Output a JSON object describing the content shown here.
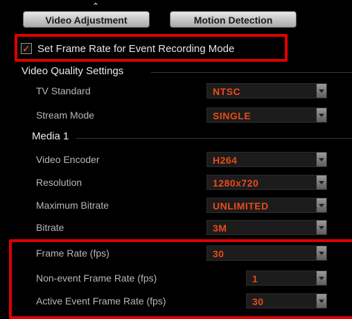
{
  "tabs": {
    "video_adjustment": "Video Adjustment",
    "motion_detection": "Motion Detection"
  },
  "event_recording": {
    "checkbox_checked": true,
    "check_glyph": "✓",
    "label": "Set Frame Rate for Event Recording Mode"
  },
  "video_quality": {
    "title": "Video Quality Settings",
    "tv_standard": {
      "label": "TV Standard",
      "value": "NTSC"
    },
    "stream_mode": {
      "label": "Stream Mode",
      "value": "SINGLE"
    }
  },
  "media1": {
    "title": "Media 1",
    "video_encoder": {
      "label": "Video Encoder",
      "value": "H264"
    },
    "resolution": {
      "label": "Resolution",
      "value": "1280x720"
    },
    "max_bitrate": {
      "label": "Maximum Bitrate",
      "value": "UNLIMITED"
    },
    "bitrate": {
      "label": "Bitrate",
      "value": "3M"
    },
    "frame_rate": {
      "label": "Frame Rate (fps)",
      "value": "30"
    },
    "nonevent_frame_rate": {
      "label": "Non-event Frame Rate (fps)",
      "value": "1"
    },
    "active_event_frame_rate": {
      "label": "Active Event Frame Rate (fps)",
      "value": "30"
    }
  },
  "colors": {
    "background": "#000000",
    "value_text": "#e84a1a",
    "highlight": "#e00000",
    "check": "#e07a1f"
  },
  "icons": {
    "cursor": "mouse-cursor-icon",
    "dropdown": "chevron-down-icon",
    "check": "checkmark-icon"
  }
}
